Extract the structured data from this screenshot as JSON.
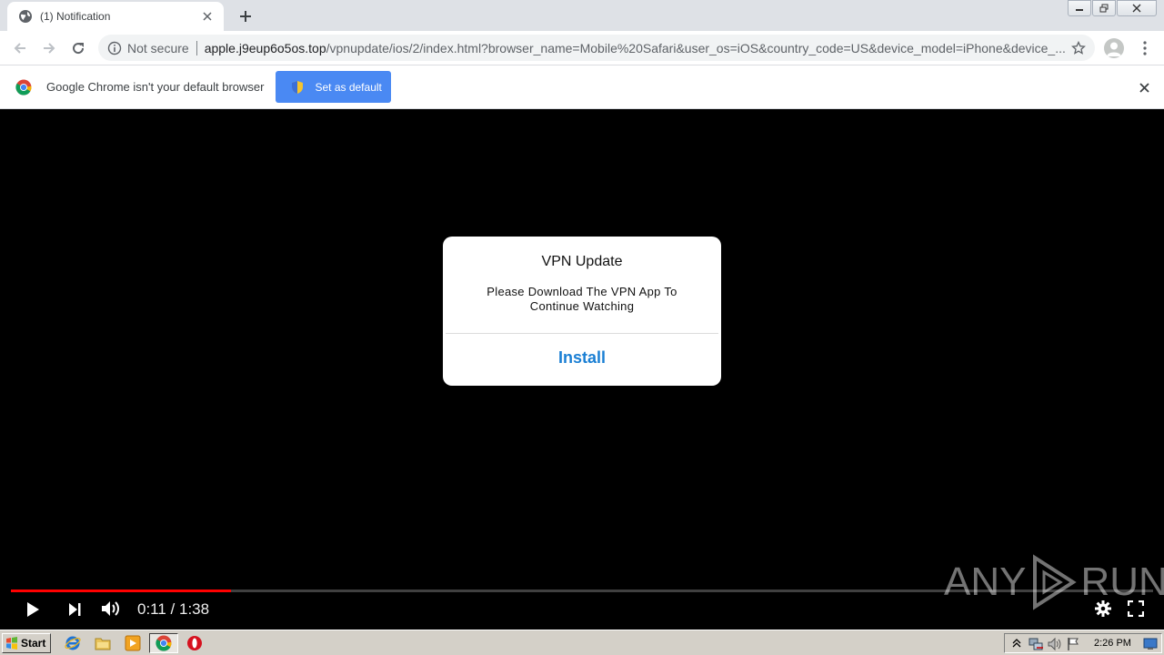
{
  "browser": {
    "tab_title": "(1) Notification",
    "security_label": "Not secure",
    "url_host": "apple.j9eup6o5os.top",
    "url_path": "/vpnupdate/ios/2/index.html?browser_name=Mobile%20Safari&user_os=iOS&country_code=US&device_model=iPhone&device_..."
  },
  "infobar": {
    "message": "Google Chrome isn't your default browser",
    "button_label": "Set as default"
  },
  "dialog": {
    "title": "VPN Update",
    "message": "Please Download The VPN App To Continue Watching",
    "button_label": "Install"
  },
  "player": {
    "current_time": "0:11",
    "duration": "1:38",
    "time_display": "0:11 / 1:38",
    "progress_fraction": 0.193
  },
  "watermark": {
    "text_left": "ANY",
    "text_right": "RUN"
  },
  "taskbar": {
    "start_label": "Start",
    "clock": "2:26 PM"
  },
  "colors": {
    "accent_blue": "#4a89f3",
    "install_blue": "#1a7fd4",
    "progress_red": "#ff0000"
  }
}
